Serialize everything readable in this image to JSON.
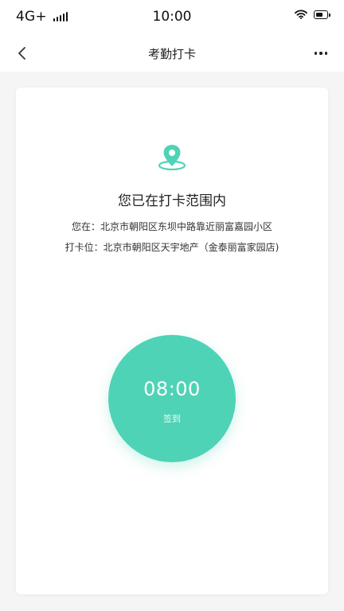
{
  "status_bar": {
    "network": "4G+",
    "time": "10:00",
    "battery_level": 0.75
  },
  "nav": {
    "title": "考勤打卡"
  },
  "checkin": {
    "status_title": "您已在打卡范围内",
    "current_location": "您在：北京市朝阳区东坝中路靠近丽富嘉园小区",
    "checkpoint_location": "打卡位：北京市朝阳区天宇地产（金泰丽富家园店)",
    "button_time": "08:00",
    "button_label": "签到"
  },
  "colors": {
    "accent": "#4fd3b6",
    "background": "#f5f5f5",
    "card": "#ffffff",
    "text": "#222222"
  },
  "icons": {
    "back": "chevron-left-icon",
    "more": "more-horizontal-icon",
    "location": "location-pin-icon",
    "signal": "signal-icon",
    "wifi": "wifi-icon",
    "battery": "battery-icon"
  }
}
